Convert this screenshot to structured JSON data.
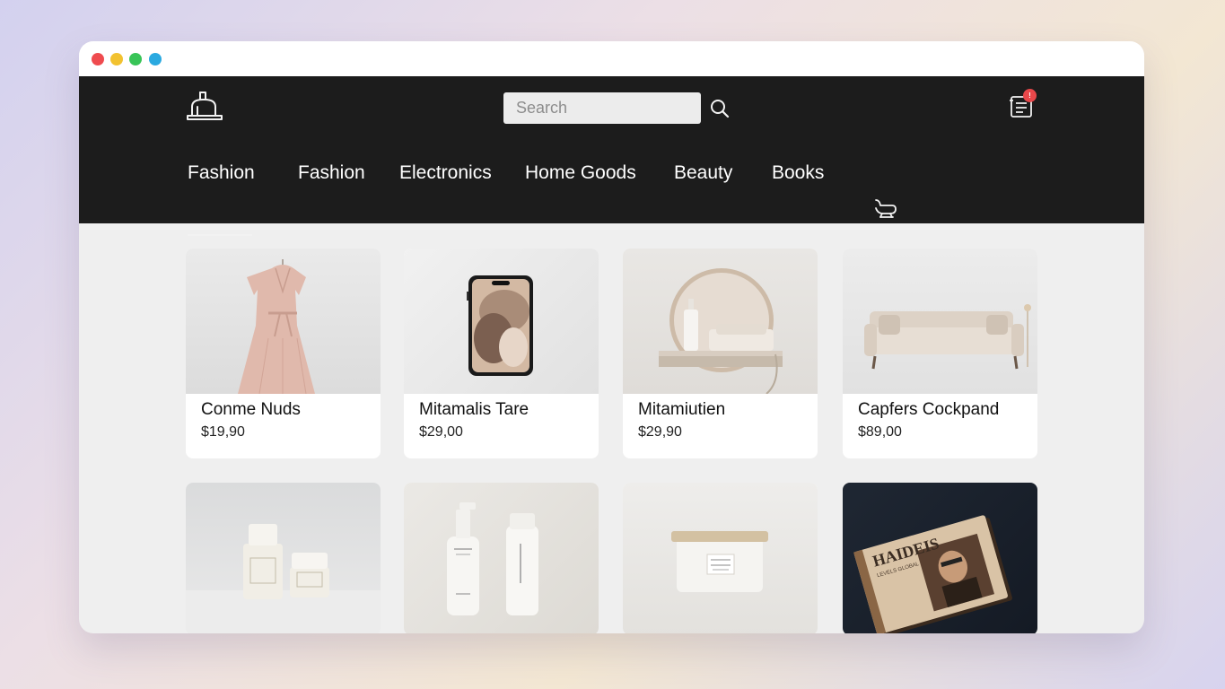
{
  "search": {
    "placeholder": "Search"
  },
  "cart": {
    "badge": "!"
  },
  "nav": {
    "items": [
      {
        "label": "Fashion"
      },
      {
        "label": "Fashion"
      },
      {
        "label": "Electronics"
      },
      {
        "label": "Home Goods"
      },
      {
        "label": "Beauty"
      },
      {
        "label": "Books"
      }
    ]
  },
  "products": [
    {
      "name": "Conme Nuds",
      "price": "$19,90"
    },
    {
      "name": "Mitamalis Tare",
      "price": "$29,00"
    },
    {
      "name": "Mitamiutien",
      "price": "$29,90"
    },
    {
      "name": "Capfers Cockpand",
      "price": "$89,00"
    }
  ],
  "book": {
    "cover_title": "HAIDEIS",
    "cover_subtitle": "LEVELS GLOBAL"
  }
}
